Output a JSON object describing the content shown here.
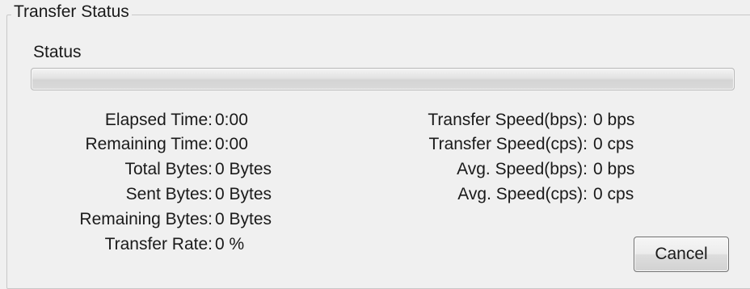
{
  "group": {
    "title": "Transfer Status",
    "status_label": "Status",
    "progress_fraction": 0
  },
  "left_stats": [
    {
      "label": "Elapsed Time:",
      "value": "0:00"
    },
    {
      "label": "Remaining Time:",
      "value": "0:00"
    },
    {
      "label": "Total Bytes:",
      "value": "0 Bytes"
    },
    {
      "label": "Sent Bytes:",
      "value": "0 Bytes"
    },
    {
      "label": "Remaining Bytes:",
      "value": "0 Bytes"
    },
    {
      "label": "Transfer Rate:",
      "value": "0 %"
    }
  ],
  "right_stats": [
    {
      "label": "Transfer Speed(bps):",
      "value": "0 bps"
    },
    {
      "label": "Transfer Speed(cps):",
      "value": "0 cps"
    },
    {
      "label": "Avg. Speed(bps):",
      "value": "0 bps"
    },
    {
      "label": "Avg. Speed(cps):",
      "value": "0 cps"
    }
  ],
  "buttons": {
    "cancel_label": "Cancel"
  },
  "colors": {
    "background": "#f0f0f0",
    "border": "#c8c8c8",
    "progress_fill": "#5ec23d"
  }
}
